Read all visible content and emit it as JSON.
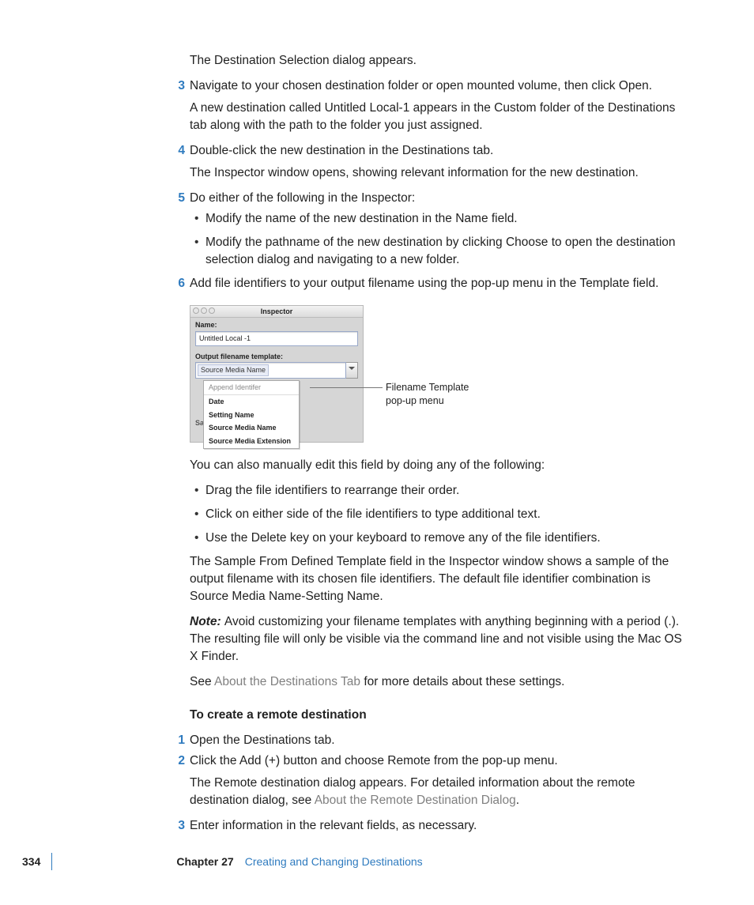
{
  "p_intro": "The Destination Selection dialog appears.",
  "step3": "Navigate to your chosen destination folder or open mounted volume, then click Open.",
  "step3_body": "A new destination called Untitled Local-1 appears in the Custom folder of the Destinations tab along with the path to the folder you just assigned.",
  "step4": "Double-click the new destination in the Destinations tab.",
  "step4_body": "The Inspector window opens, showing relevant information for the new destination.",
  "step5": "Do either of the following in the Inspector:",
  "step5_b1": "Modify the name of the new destination in the Name field.",
  "step5_b2": "Modify the pathname of the new destination by clicking Choose to open the destination selection dialog and navigating to a new folder.",
  "step6": "Add file identifiers to your output filename using the pop-up menu in the Template field.",
  "inspector": {
    "title": "Inspector",
    "name_label": "Name:",
    "name_value": "Untitled Local -1",
    "template_label": "Output filename template:",
    "token": "Source Media Name",
    "popup_title": "Append Identifer",
    "menu": [
      "Date",
      "Setting Name",
      "Source Media Name",
      "Source Media Extension"
    ],
    "sa": "Sa"
  },
  "callout1": "Filename Template",
  "callout2": "pop-up menu",
  "after_fig": "You can also manually edit this field by doing any of the following:",
  "af_b1": "Drag the file identifiers to rearrange their order.",
  "af_b2": "Click on either side of the file identifiers to type additional text.",
  "af_b3": "Use the Delete key on your keyboard to remove any of the file identifiers.",
  "sample_para": "The Sample From Defined Template field in the Inspector window shows a sample of the output filename with its chosen file identifiers. The default file identifier combination is Source Media Name-Setting Name.",
  "note_label": "Note:  ",
  "note_body": "Avoid customizing your filename templates with anything beginning with a period (.). The resulting file will only be visible via the command line and not visible using the Mac OS X Finder.",
  "see_pre": "See ",
  "see_link": "About the Destinations Tab",
  "see_post": " for more details about these settings.",
  "remote_heading": "To create a remote destination",
  "r1": "Open the Destinations tab.",
  "r2": "Click the Add (+) button and choose Remote from the pop-up menu.",
  "r2_body_pre": "The Remote destination dialog appears. For detailed information about the remote destination dialog, see ",
  "r2_link": "About the Remote Destination Dialog",
  "r2_post": ".",
  "r3": "Enter information in the relevant fields, as necessary.",
  "footer": {
    "page": "334",
    "chapter": "Chapter 27",
    "title": "Creating and Changing Destinations"
  },
  "nums": {
    "n3": "3",
    "n4": "4",
    "n5": "5",
    "n6": "6",
    "n1": "1",
    "n2": "2",
    "rn3": "3"
  }
}
